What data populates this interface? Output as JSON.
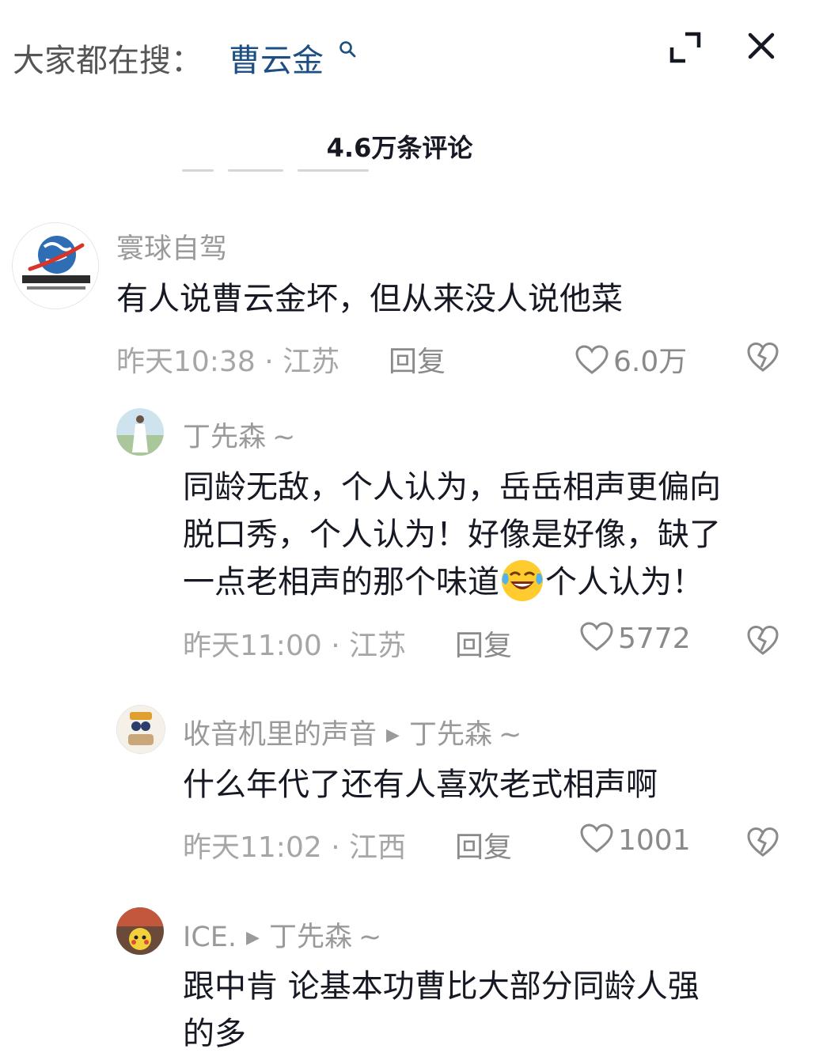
{
  "header": {
    "search_prefix": "大家都在搜：",
    "search_term": "曹云金",
    "icons": [
      "search-icon",
      "expand-icon",
      "close-icon"
    ]
  },
  "comments_title": "4.6万条评论",
  "comments": [
    {
      "username": "寰球自驾",
      "text": "有人说曹云金坏，但从来没人说他菜",
      "time": "昨天10:38 · 江苏",
      "reply": "回复",
      "likes": "6.0万"
    },
    {
      "username": "丁先森",
      "tilde": "~",
      "lines": [
        "同龄无敌，个人认为，岳岳相声更偏向",
        "脱口秀，个人认为！好像是好像，缺了"
      ],
      "line3_before": "一点老相声的那个味道",
      "line3_after": "个人认为！",
      "time": "昨天11:00 · 江苏",
      "reply": "回复",
      "likes": "5772"
    },
    {
      "username": "收音机里的声音",
      "reply_to": "丁先森",
      "tilde": "~",
      "text": "什么年代了还有人喜欢老式相声啊",
      "time": "昨天11:02 · 江西",
      "reply": "回复",
      "likes": "1001"
    },
    {
      "username": "ICE.",
      "reply_to": "丁先森",
      "tilde": "~",
      "lines": [
        "跟中肯 论基本功曹比大部分同龄人强",
        "的多"
      ]
    }
  ],
  "colors": {
    "link": "#1e4f82",
    "muted": "#9a9a9a",
    "text": "#161823"
  }
}
